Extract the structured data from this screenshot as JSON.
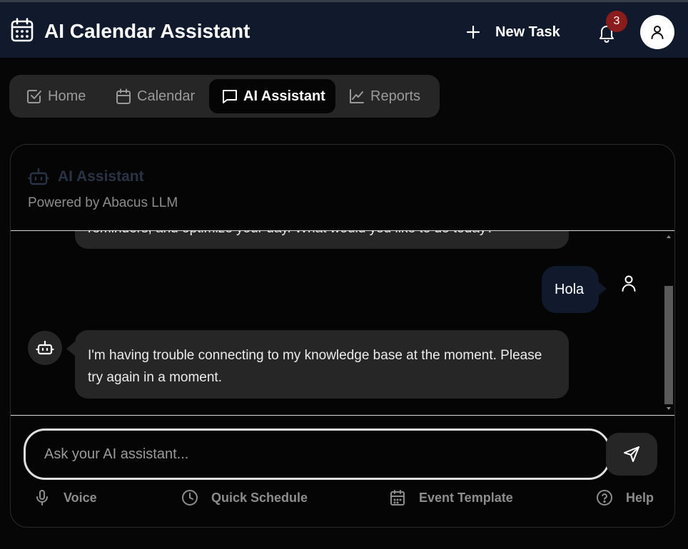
{
  "header": {
    "title": "AI Calendar Assistant",
    "new_task_label": "New Task",
    "notification_count": "3"
  },
  "tabs": [
    {
      "label": "Home",
      "icon": "check-square-icon",
      "active": false
    },
    {
      "label": "Calendar",
      "icon": "calendar-icon",
      "active": false
    },
    {
      "label": "AI Assistant",
      "icon": "message-square-icon",
      "active": true
    },
    {
      "label": "Reports",
      "icon": "line-chart-icon",
      "active": false
    }
  ],
  "assistant": {
    "title": "AI Assistant",
    "subtitle": "Powered by Abacus LLM"
  },
  "messages": [
    {
      "role": "assistant",
      "text": "reminders, and optimize your day. What would you like to do today?",
      "partial": true
    },
    {
      "role": "user",
      "text": "Hola"
    },
    {
      "role": "assistant",
      "text": "I'm having trouble connecting to my knowledge base at the moment. Please try again in a moment."
    }
  ],
  "input": {
    "placeholder": "Ask your AI assistant...",
    "value": ""
  },
  "tools": [
    {
      "label": "Voice",
      "icon": "microphone-icon"
    },
    {
      "label": "Quick Schedule",
      "icon": "clock-icon"
    },
    {
      "label": "Event Template",
      "icon": "calendar-icon"
    },
    {
      "label": "Help",
      "icon": "help-circle-icon"
    }
  ],
  "colors": {
    "header_bg": "#111a2c",
    "page_bg": "#060606",
    "surface": "#262626",
    "badge": "#8a1c1c"
  }
}
